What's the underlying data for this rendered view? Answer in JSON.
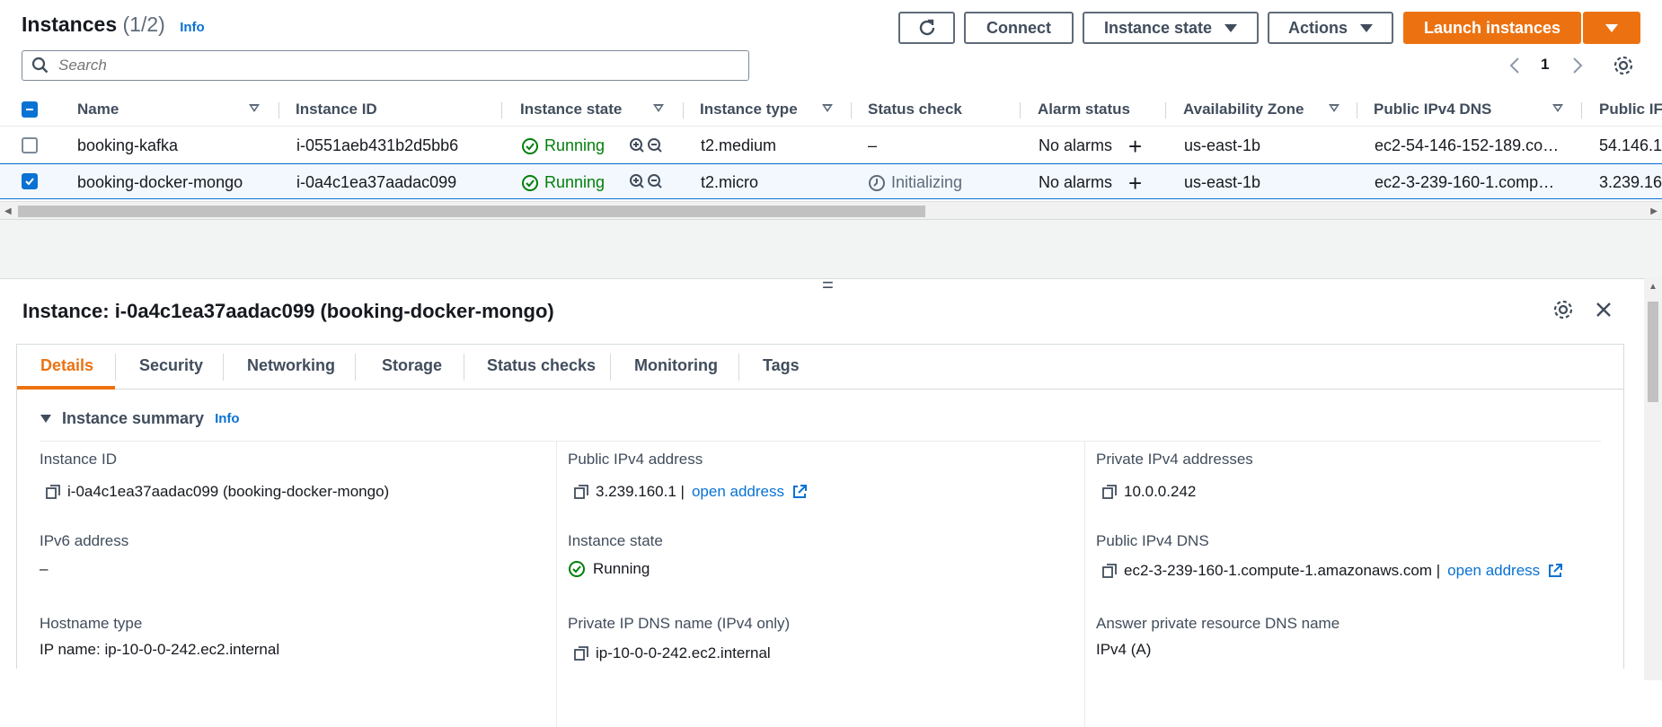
{
  "header": {
    "title": "Instances",
    "count": "(1/2)",
    "info": "Info",
    "buttons": {
      "connect": "Connect",
      "instance_state": "Instance state",
      "actions": "Actions",
      "launch": "Launch instances"
    },
    "search_placeholder": "Search",
    "page_number": "1"
  },
  "table": {
    "columns": [
      "Name",
      "Instance ID",
      "Instance state",
      "Instance type",
      "Status check",
      "Alarm status",
      "Availability Zone",
      "Public IPv4 DNS",
      "Public IF"
    ],
    "rows": [
      {
        "selected": false,
        "name": "booking-kafka",
        "instance_id": "i-0551aeb431b2d5bb6",
        "state": "Running",
        "type": "t2.medium",
        "status_check": "–",
        "alarm": "No alarms",
        "az": "us-east-1b",
        "dns": "ec2-54-146-152-189.co…",
        "ip": "54.146.1"
      },
      {
        "selected": true,
        "name": "booking-docker-mongo",
        "instance_id": "i-0a4c1ea37aadac099",
        "state": "Running",
        "type": "t2.micro",
        "status_check": "Initializing",
        "alarm": "No alarms",
        "az": "us-east-1b",
        "dns": "ec2-3-239-160-1.comp…",
        "ip": "3.239.16"
      }
    ]
  },
  "panel": {
    "title": "Instance: i-0a4c1ea37aadac099 (booking-docker-mongo)",
    "tabs": [
      "Details",
      "Security",
      "Networking",
      "Storage",
      "Status checks",
      "Monitoring",
      "Tags"
    ],
    "section_title": "Instance summary",
    "section_info": "Info",
    "fields": {
      "instance_id_label": "Instance ID",
      "instance_id_value": "i-0a4c1ea37aadac099 (booking-docker-mongo)",
      "ipv6_label": "IPv6 address",
      "ipv6_value": "–",
      "hostname_label": "Hostname type",
      "hostname_value": "IP name: ip-10-0-0-242.ec2.internal",
      "public_ip_label": "Public IPv4 address",
      "public_ip_value": "3.239.160.1 |",
      "open_address": "open address",
      "state_label": "Instance state",
      "state_value": "Running",
      "private_dns_label": "Private IP DNS name (IPv4 only)",
      "private_dns_value": "ip-10-0-0-242.ec2.internal",
      "private_ip_label": "Private IPv4 addresses",
      "private_ip_value": "10.0.0.242",
      "public_dns_label": "Public IPv4 DNS",
      "public_dns_value": "ec2-3-239-160-1.compute-1.amazonaws.com |",
      "answer_dns_label": "Answer private resource DNS name",
      "answer_dns_value": "IPv4 (A)"
    }
  },
  "colors": {
    "accent": "#ec7211",
    "link": "#0972d3",
    "success": "#037f0c"
  }
}
